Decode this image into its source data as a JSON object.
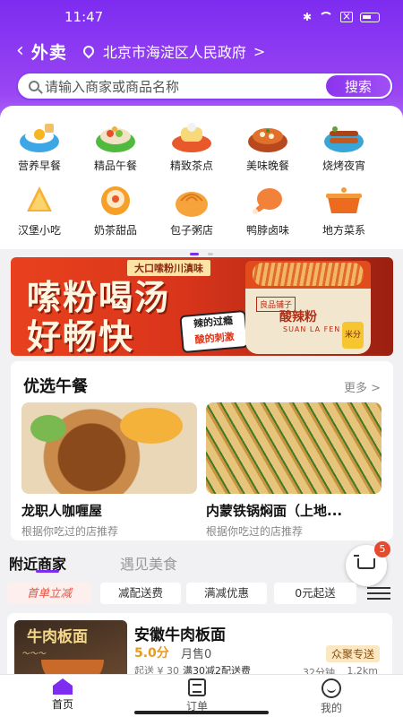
{
  "status_bar": {
    "time": "11:47",
    "battery_icon": "battery-icon"
  },
  "header": {
    "back_icon": "chevron-left-icon",
    "title": "外卖",
    "location_icon": "location-pin-icon",
    "address": "北京市海淀区人民政府",
    "address_chevron": ">"
  },
  "search": {
    "placeholder": "请输入商家或商品名称",
    "button_label": "搜索"
  },
  "categories": [
    {
      "label": "营养早餐",
      "icon": "breakfast-icon"
    },
    {
      "label": "精品午餐",
      "icon": "lunch-icon"
    },
    {
      "label": "精致茶点",
      "icon": "dessert-tea-icon"
    },
    {
      "label": "美味晚餐",
      "icon": "dinner-icon"
    },
    {
      "label": "烧烤夜宵",
      "icon": "bbq-icon"
    },
    {
      "label": "汉堡小吃",
      "icon": "burger-snack-icon"
    },
    {
      "label": "奶茶甜品",
      "icon": "milk-tea-icon"
    },
    {
      "label": "包子粥店",
      "icon": "bun-icon"
    },
    {
      "label": "鸭脖卤味",
      "icon": "duck-neck-icon"
    },
    {
      "label": "地方菜系",
      "icon": "local-cuisine-icon"
    }
  ],
  "banner": {
    "tag": "大口嗦粉川滇味",
    "line1": "嗦粉喝汤",
    "line2": "好畅快",
    "sticker_line1": "辣的过瘾",
    "sticker_line2": "酸的刺激",
    "product_logo": "良品铺子",
    "product_name": "酸辣粉",
    "product_sub": "SUAN LA FEN",
    "product_badge": "米分"
  },
  "featured": {
    "title": "优选午餐",
    "more_label": "更多 >",
    "items": [
      {
        "name": "龙职人咖喱屋",
        "subtitle": "根据你吃过的店推荐"
      },
      {
        "name": "内蒙铁锅焖面（上地...",
        "subtitle": "根据你吃过的店推荐"
      }
    ]
  },
  "tabs": {
    "active": "附近商家",
    "inactive": "遇见美食"
  },
  "cart": {
    "badge": "5"
  },
  "filters": [
    "首单立减",
    "减配送费",
    "满减优惠",
    "0元起送"
  ],
  "merchant": {
    "image_title": "牛肉板面",
    "name": "安徽牛肉板面",
    "score": "5.0分",
    "sold": "月售0",
    "delivery_tag": "众聚专送",
    "min_order": "起送 ¥ 30",
    "promo": "满30减2配送费",
    "time": "32分钟",
    "distance": "1.2km"
  },
  "bottom_nav": [
    {
      "label": "首页",
      "icon": "home-icon",
      "active": true
    },
    {
      "label": "订单",
      "icon": "order-icon",
      "active": false
    },
    {
      "label": "我的",
      "icon": "profile-icon",
      "active": false
    }
  ],
  "colors": {
    "accent": "#7d2cf0",
    "promo": "#e35440",
    "score": "#e89a1c"
  }
}
